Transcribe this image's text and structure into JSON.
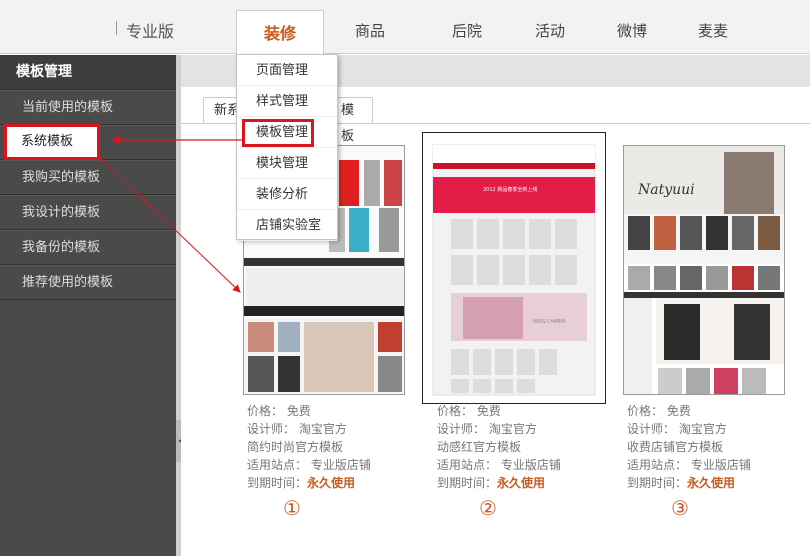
{
  "header": {
    "brand": "专业版",
    "nav": [
      "装修",
      "商品",
      "后院",
      "活动",
      "微博",
      "麦麦"
    ],
    "active_nav": "装修"
  },
  "sidebar": {
    "title": "模板管理",
    "items": [
      "当前使用的模板",
      "系统模板",
      "我购买的模板",
      "我设计的模板",
      "我备份的模板",
      "推荐使用的模板"
    ],
    "selected": "系统模板"
  },
  "dropdown": {
    "items": [
      "页面管理",
      "样式管理",
      "模板管理",
      "模块管理",
      "装修分析",
      "店铺实验室"
    ],
    "highlighted": "模板管理"
  },
  "tabs": [
    "新系",
    "模板"
  ],
  "templates": [
    {
      "price": "价格：  免费",
      "designer": "设计师：  淘宝官方",
      "name": "简约时尚官方模板",
      "site": "适用站点：  专业版店铺",
      "expire_label": "到期时间：",
      "expire_value": "永久使用",
      "marker": "①"
    },
    {
      "price": "价格：  免费",
      "designer": "设计师：  淘宝官方",
      "name": "动感红官方模板",
      "site": "适用站点：  专业版店铺",
      "expire_label": "到期时间：",
      "expire_value": "永久使用",
      "marker": "②",
      "thumb_text": [
        "2012 新品春季全新上线",
        "MISS.CHARM"
      ]
    },
    {
      "price": "价格：  免费",
      "designer": "设计师：  淘宝官方",
      "name": "收费店铺官方模板",
      "site": "适用站点：  专业版店铺",
      "expire_label": "到期时间：",
      "expire_value": "永久使用",
      "marker": "③",
      "thumb_text": [
        "Natyuui"
      ]
    }
  ],
  "colors": {
    "accent": "#c95a1b",
    "highlight": "#d9161c",
    "sidebar": "#4a4a4a"
  }
}
